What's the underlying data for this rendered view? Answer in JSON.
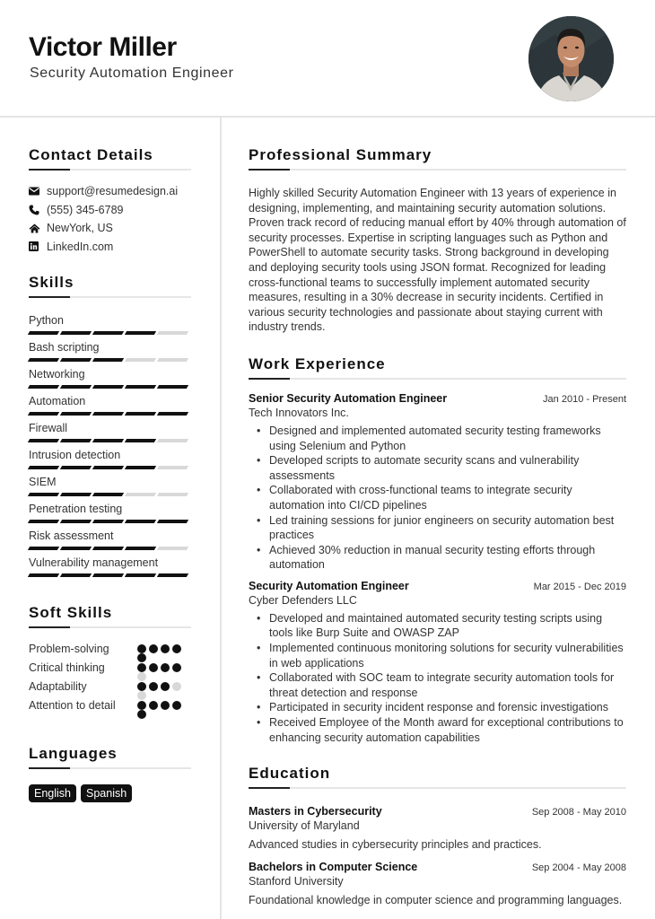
{
  "header": {
    "name": "Victor Miller",
    "title": "Security Automation Engineer",
    "photo_alt": "Profile photo of Victor Miller"
  },
  "contact": {
    "heading": "Contact Details",
    "items": [
      {
        "icon": "envelope-icon",
        "text": "support@resumedesign.ai"
      },
      {
        "icon": "phone-icon",
        "text": "(555) 345-6789"
      },
      {
        "icon": "home-icon",
        "text": "NewYork, US"
      },
      {
        "icon": "linkedin-icon",
        "text": "LinkedIn.com"
      }
    ]
  },
  "skills": {
    "heading": "Skills",
    "max": 5,
    "items": [
      {
        "name": "Python",
        "level": 4
      },
      {
        "name": "Bash scripting",
        "level": 3
      },
      {
        "name": "Networking",
        "level": 5
      },
      {
        "name": "Automation",
        "level": 5
      },
      {
        "name": "Firewall",
        "level": 4
      },
      {
        "name": "Intrusion detection",
        "level": 4
      },
      {
        "name": "SIEM",
        "level": 3
      },
      {
        "name": "Penetration testing",
        "level": 5
      },
      {
        "name": "Risk assessment",
        "level": 4
      },
      {
        "name": "Vulnerability management",
        "level": 5
      }
    ]
  },
  "soft_skills": {
    "heading": "Soft Skills",
    "max": 5,
    "items": [
      {
        "name": "Problem-solving",
        "level": 5
      },
      {
        "name": "Critical thinking",
        "level": 4
      },
      {
        "name": "Adaptability",
        "level": 3
      },
      {
        "name": "Attention to detail",
        "level": 5
      }
    ]
  },
  "languages": {
    "heading": "Languages",
    "items": [
      "English",
      "Spanish"
    ]
  },
  "summary": {
    "heading": "Professional Summary",
    "text": "Highly skilled Security Automation Engineer with 13 years of experience in designing, implementing, and maintaining security automation solutions. Proven track record of reducing manual effort by 40% through automation of security processes. Expertise in scripting languages such as Python and PowerShell to automate security tasks. Strong background in developing and deploying security tools using JSON format. Recognized for leading cross-functional teams to successfully implement automated security measures, resulting in a 30% decrease in security incidents. Certified in various security technologies and passionate about staying current with industry trends."
  },
  "work": {
    "heading": "Work Experience",
    "jobs": [
      {
        "role": "Senior Security Automation Engineer",
        "date": "Jan 2010 - Present",
        "company": "Tech Innovators Inc.",
        "bullets": [
          "Designed and implemented automated security testing frameworks using Selenium and Python",
          "Developed scripts to automate security scans and vulnerability assessments",
          "Collaborated with cross-functional teams to integrate security automation into CI/CD pipelines",
          "Led training sessions for junior engineers on security automation best practices",
          "Achieved 30% reduction in manual security testing efforts through automation"
        ]
      },
      {
        "role": "Security Automation Engineer",
        "date": "Mar 2015 - Dec 2019",
        "company": "Cyber Defenders LLC",
        "bullets": [
          "Developed and maintained automated security testing scripts using tools like Burp Suite and OWASP ZAP",
          "Implemented continuous monitoring solutions for security vulnerabilities in web applications",
          "Collaborated with SOC team to integrate security automation tools for threat detection and response",
          "Participated in security incident response and forensic investigations",
          "Received Employee of the Month award for exceptional contributions to enhancing security automation capabilities"
        ]
      }
    ]
  },
  "education": {
    "heading": "Education",
    "items": [
      {
        "degree": "Masters in Cybersecurity",
        "date": "Sep 2008 - May 2010",
        "school": "University of Maryland",
        "desc": "Advanced studies in cybersecurity principles and practices."
      },
      {
        "degree": "Bachelors in Computer Science",
        "date": "Sep 2004 - May 2008",
        "school": "Stanford University",
        "desc": "Foundational knowledge in computer science and programming languages."
      }
    ]
  }
}
